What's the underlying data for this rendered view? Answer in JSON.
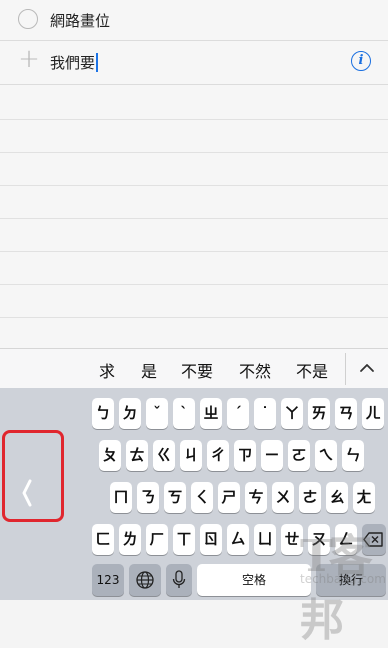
{
  "list": {
    "items": [
      {
        "text": "網路畫位"
      },
      {
        "text": "我們要"
      }
    ]
  },
  "suggestions": [
    "求",
    "是",
    "不要",
    "不然",
    "不是"
  ],
  "keyboard": {
    "row1": [
      "ㄅ",
      "ㄉ",
      "ˇ",
      "ˋ",
      "ㄓ",
      "ˊ",
      "˙",
      "ㄚ",
      "ㄞ",
      "ㄢ",
      "ㄦ"
    ],
    "row2": [
      "ㄆ",
      "ㄊ",
      "ㄍ",
      "ㄐ",
      "ㄔ",
      "ㄗ",
      "ㄧ",
      "ㄛ",
      "ㄟ",
      "ㄣ"
    ],
    "row3": [
      "ㄇ",
      "ㄋ",
      "ㄎ",
      "ㄑ",
      "ㄕ",
      "ㄘ",
      "ㄨ",
      "ㄜ",
      "ㄠ",
      "ㄤ"
    ],
    "row4": [
      "ㄈ",
      "ㄌ",
      "ㄏ",
      "ㄒ",
      "ㄖ",
      "ㄙ",
      "ㄩ",
      "ㄝ",
      "ㄡ",
      "ㄥ"
    ],
    "num_label": "123",
    "space_label": "空格",
    "return_label": "換行"
  },
  "watermark": {
    "cn": "T客邦",
    "url": "techbang.com"
  },
  "colors": {
    "accent": "#1a6fe0",
    "highlight": "#e0262e"
  },
  "icons": [
    "info-icon",
    "plus-icon",
    "chevron-up-icon",
    "globe-icon",
    "mic-icon",
    "delete-icon",
    "back-chevron-icon"
  ]
}
